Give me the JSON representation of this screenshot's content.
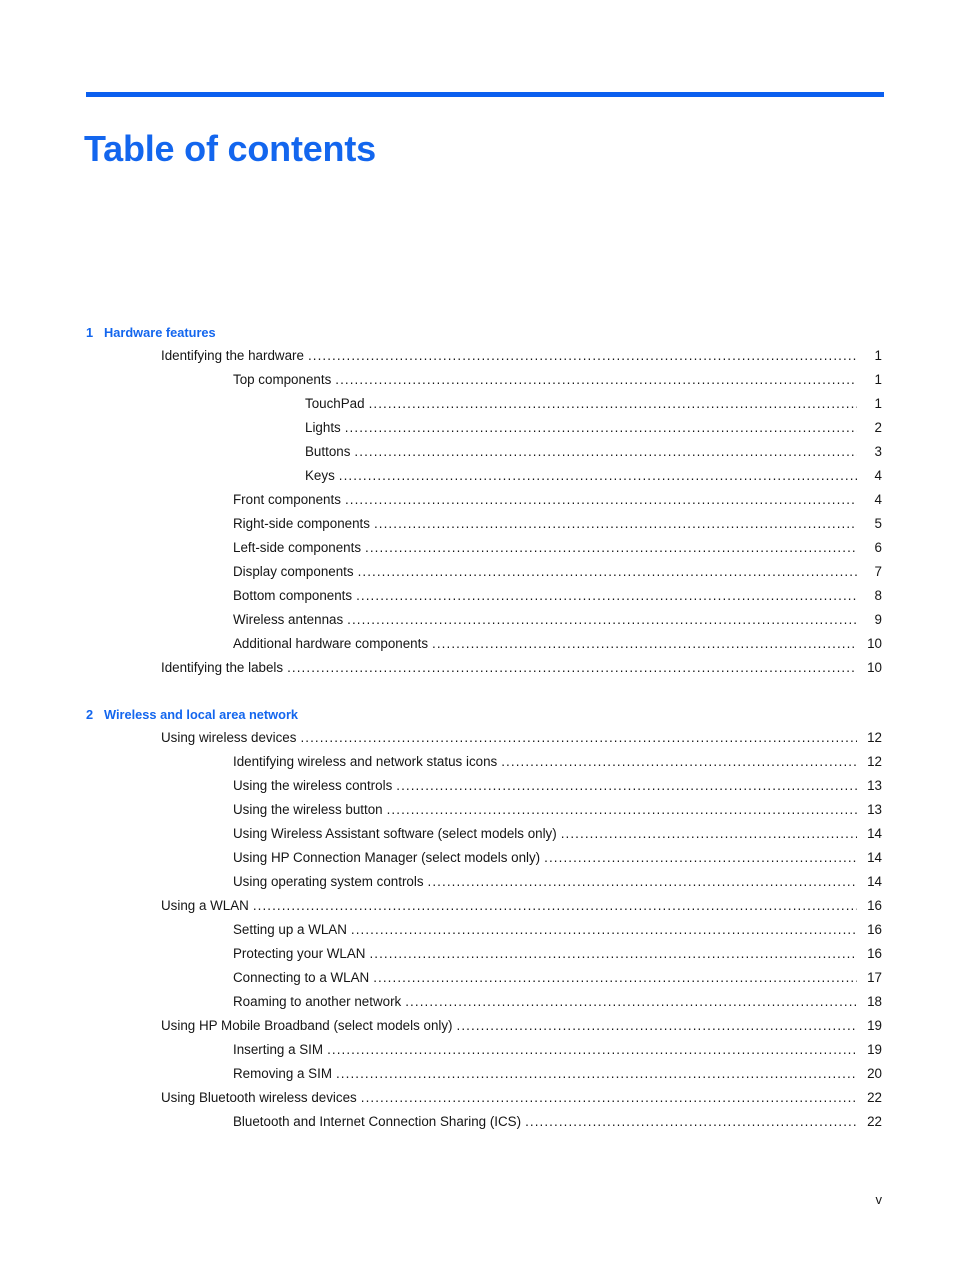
{
  "document": {
    "title": "Table of contents",
    "accent_color": "#1366EE",
    "rule_color": "#0B5FEF",
    "footer_page": "v"
  },
  "chapters": [
    {
      "number": "1",
      "title": "Hardware features",
      "entries": [
        {
          "level": 1,
          "label": "Identifying the hardware",
          "page": "1"
        },
        {
          "level": 2,
          "label": "Top components",
          "page": "1"
        },
        {
          "level": 3,
          "label": "TouchPad",
          "page": "1"
        },
        {
          "level": 3,
          "label": "Lights",
          "page": "2"
        },
        {
          "level": 3,
          "label": "Buttons",
          "page": "3"
        },
        {
          "level": 3,
          "label": "Keys",
          "page": "4"
        },
        {
          "level": 2,
          "label": "Front components",
          "page": "4"
        },
        {
          "level": 2,
          "label": "Right-side components",
          "page": "5"
        },
        {
          "level": 2,
          "label": "Left-side components",
          "page": "6"
        },
        {
          "level": 2,
          "label": "Display components",
          "page": "7"
        },
        {
          "level": 2,
          "label": "Bottom components",
          "page": "8"
        },
        {
          "level": 2,
          "label": "Wireless antennas",
          "page": "9"
        },
        {
          "level": 2,
          "label": "Additional hardware components",
          "page": "10"
        },
        {
          "level": 1,
          "label": "Identifying the labels",
          "page": "10"
        }
      ]
    },
    {
      "number": "2",
      "title": "Wireless and local area network",
      "entries": [
        {
          "level": 1,
          "label": "Using wireless devices",
          "page": "12"
        },
        {
          "level": 2,
          "label": "Identifying wireless and network status icons",
          "page": "12"
        },
        {
          "level": 2,
          "label": "Using the wireless controls",
          "page": "13"
        },
        {
          "level": 2,
          "label": "Using the wireless button",
          "page": "13"
        },
        {
          "level": 2,
          "label": "Using Wireless Assistant software (select models only)",
          "page": "14"
        },
        {
          "level": 2,
          "label": "Using HP Connection Manager (select models only)",
          "page": "14"
        },
        {
          "level": 2,
          "label": "Using operating system controls",
          "page": "14"
        },
        {
          "level": 1,
          "label": "Using a WLAN",
          "page": "16"
        },
        {
          "level": 2,
          "label": "Setting up a WLAN",
          "page": "16"
        },
        {
          "level": 2,
          "label": "Protecting your WLAN",
          "page": "16"
        },
        {
          "level": 2,
          "label": "Connecting to a WLAN",
          "page": "17"
        },
        {
          "level": 2,
          "label": "Roaming to another network",
          "page": "18"
        },
        {
          "level": 1,
          "label": "Using HP Mobile Broadband (select models only)",
          "page": "19"
        },
        {
          "level": 2,
          "label": "Inserting a SIM",
          "page": "19"
        },
        {
          "level": 2,
          "label": "Removing a SIM",
          "page": "20"
        },
        {
          "level": 1,
          "label": "Using Bluetooth wireless devices",
          "page": "22"
        },
        {
          "level": 2,
          "label": "Bluetooth and Internet Connection Sharing (ICS)",
          "page": "22"
        }
      ]
    }
  ]
}
